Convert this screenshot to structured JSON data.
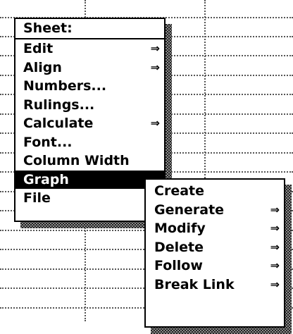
{
  "sheet_menu": {
    "title": "Sheet:",
    "items": [
      {
        "label": "Edit",
        "submenu_glyph": "⇒"
      },
      {
        "label": "Align",
        "submenu_glyph": "⇒"
      },
      {
        "label": "Numbers..."
      },
      {
        "label": "Rulings..."
      },
      {
        "label": "Calculate",
        "submenu_glyph": "⇒"
      },
      {
        "label": "Font..."
      },
      {
        "label": "Column Width"
      },
      {
        "label": "Graph",
        "selected": true
      },
      {
        "label": "File"
      }
    ]
  },
  "graph_submenu": {
    "items": [
      {
        "label": "Create"
      },
      {
        "label": "Generate",
        "submenu_glyph": "⇒"
      },
      {
        "label": "Modify",
        "submenu_glyph": "⇒"
      },
      {
        "label": "Delete",
        "submenu_glyph": "⇒"
      },
      {
        "label": "Follow",
        "submenu_glyph": "⇒"
      },
      {
        "label": "Break Link",
        "submenu_glyph": "⇒"
      }
    ]
  },
  "icons": {
    "submenu_arrow": "double-right-arrow-icon"
  },
  "colors": {
    "background": "#ffffff",
    "text": "#000000",
    "selected_background": "#000000",
    "selected_text": "#ffffff",
    "grid": "#555555"
  }
}
